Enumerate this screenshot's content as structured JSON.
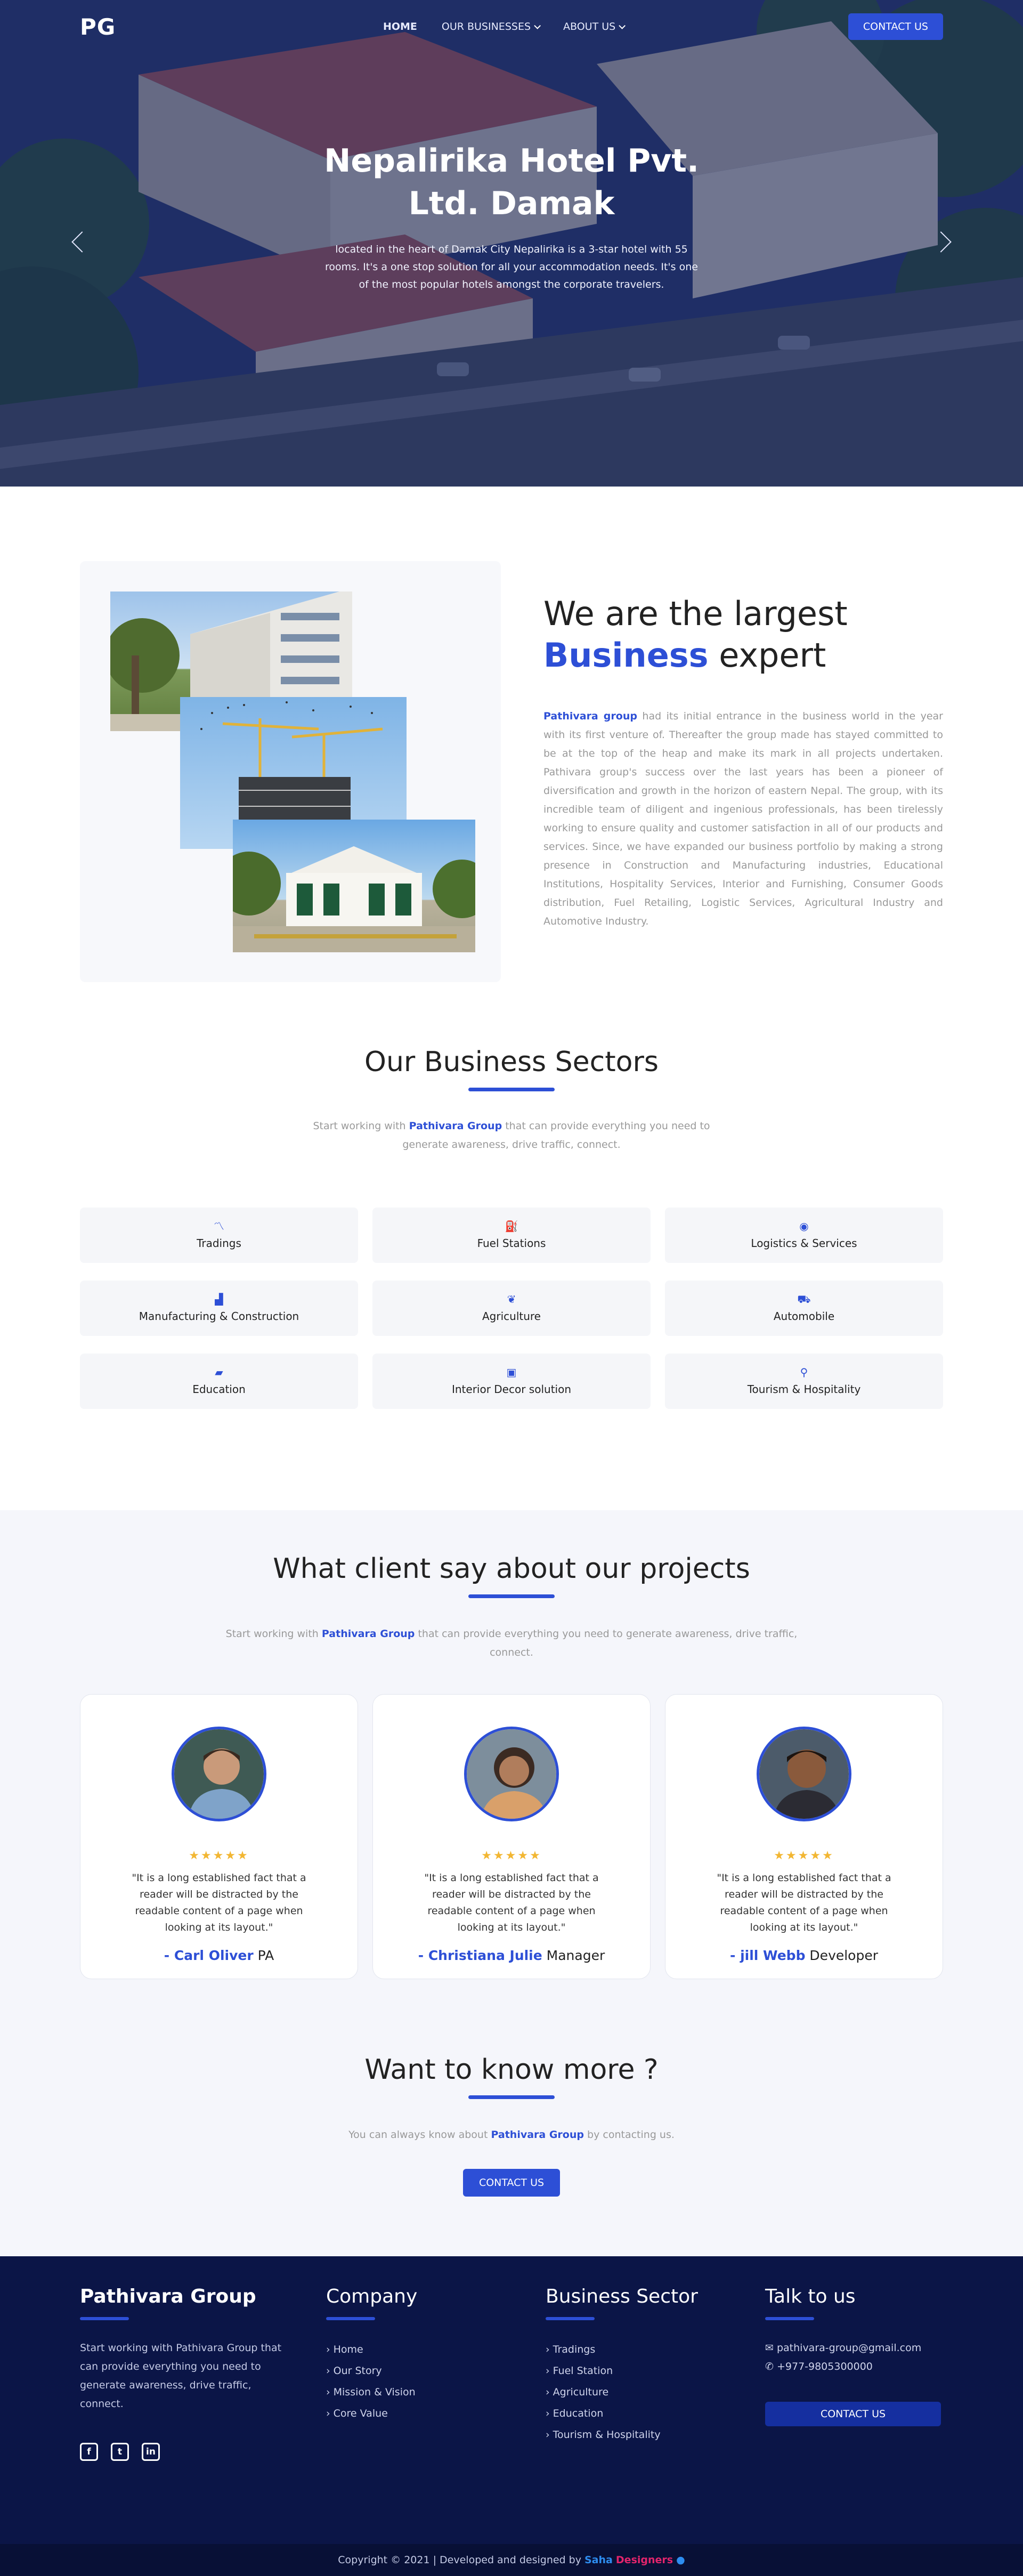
{
  "nav": {
    "logo": "PG",
    "items": [
      {
        "label": "HOME"
      },
      {
        "label": "OUR BUSINESSES"
      },
      {
        "label": "ABOUT US"
      }
    ],
    "contact_label": "CONTACT US"
  },
  "hero": {
    "title": "Nepalirika Hotel Pvt. Ltd. Damak",
    "text": "located in the heart of Damak City Nepalirika is a 3-star hotel with 55 rooms. It's a one stop solution for all your accommodation needs. It's one of the most popular hotels amongst the corporate travelers."
  },
  "about": {
    "heading_1": "We are the largest",
    "heading_accent": "Business",
    "heading_2": "expert",
    "brand": "Pathivara group",
    "text": "had its initial entrance in the business world in the year with its first venture of. Thereafter the group made has stayed committed to be at the top of the heap and make its mark in all projects undertaken. Pathivara group's success over the last years has been a pioneer of diversification and growth in the horizon of eastern Nepal. The group, with its incredible team of diligent and ingenious professionals, has been tirelessly working to ensure quality and customer satisfaction in all of our products and services. Since, we have expanded our business portfolio by making a strong presence in Construction and Manufacturing industries, Educational Institutions, Hospitality Services, Interior and Furnishing, Consumer Goods distribution, Fuel Retailing, Logistic Services, Agricultural Industry and Automotive Industry."
  },
  "sectors": {
    "title": "Our Business Sectors",
    "sub_pre": "Start working with",
    "brand": "Pathivara Group",
    "sub_post": "that can provide everything you need to generate awareness, drive traffic, connect.",
    "items": [
      {
        "label": "Tradings",
        "icon": "chart-line-icon",
        "glyph": "📈"
      },
      {
        "label": "Fuel Stations",
        "icon": "fuel-drop-icon",
        "glyph": "💧"
      },
      {
        "label": "Logistics & Services",
        "icon": "eye-icon",
        "glyph": "👁"
      },
      {
        "label": "Manufacturing & Construction",
        "icon": "industry-icon",
        "glyph": "🏭"
      },
      {
        "label": "Agriculture",
        "icon": "leaf-icon",
        "glyph": "🍃"
      },
      {
        "label": "Automobile",
        "icon": "car-icon",
        "glyph": "🚗"
      },
      {
        "label": "Education",
        "icon": "book-icon",
        "glyph": "📘"
      },
      {
        "label": "Interior Decor solution",
        "icon": "gift-icon",
        "glyph": "🎁"
      },
      {
        "label": "Tourism & Hospitality",
        "icon": "map-marker-icon",
        "glyph": "📍"
      }
    ]
  },
  "testimonials": {
    "title": "What client say about our projects",
    "sub_pre": "Start working with",
    "brand": "Pathivara Group",
    "sub_post": "that can provide everything you need to generate awareness, drive traffic, connect.",
    "items": [
      {
        "stars": "★★★★★",
        "quote": "\"It is a long established fact that a reader will be distracted by the readable content of a page when looking at its layout.\"",
        "dash": "- ",
        "name": "Carl Oliver",
        "role": " PA"
      },
      {
        "stars": "★★★★★",
        "quote": "\"It is a long established fact that a reader will be distracted by the readable content of a page when looking at its layout.\"",
        "dash": "- ",
        "name": "Christiana Julie",
        "role": " Manager"
      },
      {
        "stars": "★★★★★",
        "quote": "\"It is a long established fact that a reader will be distracted by the readable content of a page when looking at its layout.\"",
        "dash": "- ",
        "name": "jill Webb",
        "role": " Developer"
      }
    ]
  },
  "cta": {
    "title": "Want to know more ?",
    "sub_pre": "You can always know about",
    "brand": "Pathivara Group",
    "sub_post": "by contacting us.",
    "button": "CONTACT US"
  },
  "footer": {
    "brand_title": "Pathivara Group",
    "brand_text": "Start working with Pathivara Group that can provide everything you need to generate awareness, drive traffic, connect.",
    "company_title": "Company",
    "company_links": [
      "› Home",
      "› Our Story",
      "› Mission & Vision",
      "› Core Value"
    ],
    "sector_title": "Business Sector",
    "sector_links": [
      "› Tradings",
      "› Fuel Station",
      "› Agriculture",
      "› Education",
      "› Tourism & Hospitality"
    ],
    "talk_title": "Talk to us",
    "email": "pathivara-group@gmail.com",
    "phone": "+977-9805300000",
    "button": "CONTACT US",
    "copyright": "Copyright © 2021 | Developed and designed by",
    "designer_1": "Saha",
    "designer_2": "Designers"
  },
  "colors": {
    "accent": "#2d4fd6",
    "footer_bg": "#0b1547",
    "star": "#f2b632"
  }
}
